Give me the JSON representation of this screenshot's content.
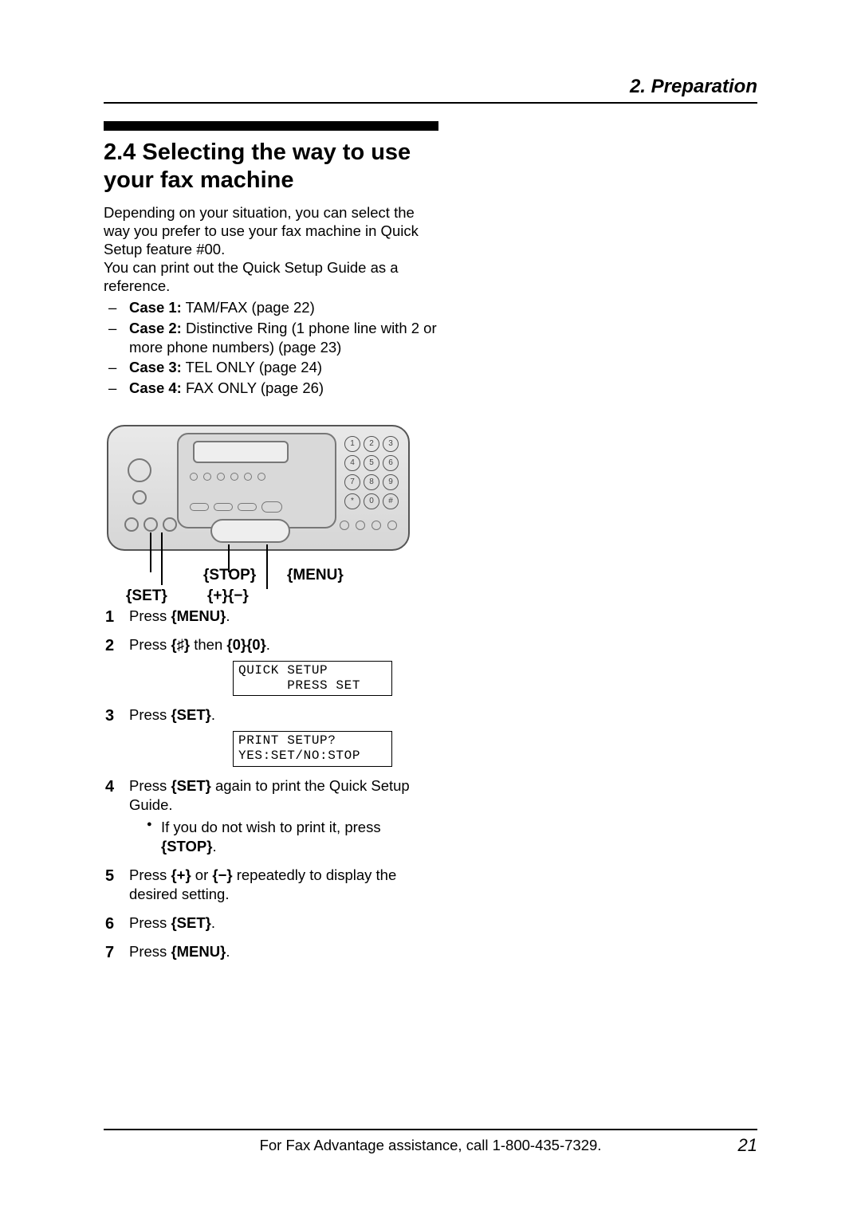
{
  "header": {
    "chapter": "2. Preparation"
  },
  "section": {
    "title": "2.4 Selecting the way to use your fax machine",
    "intro1": "Depending on your situation, you can select the way you prefer to use your fax machine in Quick Setup feature #00.",
    "intro2": "You can print out the Quick Setup Guide as a reference."
  },
  "cases": [
    {
      "label": "Case 1:",
      "text": " TAM/FAX (page 22)"
    },
    {
      "label": "Case 2:",
      "text": " Distinctive Ring (1 phone line with 2 or more phone numbers) (page 23)"
    },
    {
      "label": "Case 3:",
      "text": " TEL ONLY (page 24)"
    },
    {
      "label": "Case 4:",
      "text": " FAX ONLY (page 26)"
    }
  ],
  "keypad": [
    "1",
    "2",
    "3",
    "4",
    "5",
    "6",
    "7",
    "8",
    "9",
    "*",
    "0",
    "#"
  ],
  "callouts": {
    "stop": "{STOP}",
    "menu": "{MENU}",
    "set": "{SET}",
    "plusminus": "{+}{−}"
  },
  "steps": {
    "s1_pre": "Press ",
    "s1_key": "{MENU}",
    "s1_post": ".",
    "s2_pre": "Press ",
    "s2_key1": "{♯}",
    "s2_mid": " then ",
    "s2_key2": "{0}{0}",
    "s2_post": ".",
    "lcd1": "QUICK SETUP\n      PRESS SET",
    "s3_pre": "Press ",
    "s3_key": "{SET}",
    "s3_post": ".",
    "lcd2": "PRINT SETUP?\nYES:SET/NO:STOP",
    "s4_pre": "Press ",
    "s4_key": "{SET}",
    "s4_post": " again to print the Quick Setup Guide.",
    "s4_sub_pre": "If you do not wish to print it, press ",
    "s4_sub_key": "{STOP}",
    "s4_sub_post": ".",
    "s5_pre": "Press ",
    "s5_key1": "{+}",
    "s5_mid": " or ",
    "s5_key2": "{−}",
    "s5_post": " repeatedly to display the desired setting.",
    "s6_pre": "Press ",
    "s6_key": "{SET}",
    "s6_post": ".",
    "s7_pre": "Press ",
    "s7_key": "{MENU}",
    "s7_post": "."
  },
  "footer": {
    "text": "For Fax Advantage assistance, call 1-800-435-7329.",
    "page": "21"
  }
}
